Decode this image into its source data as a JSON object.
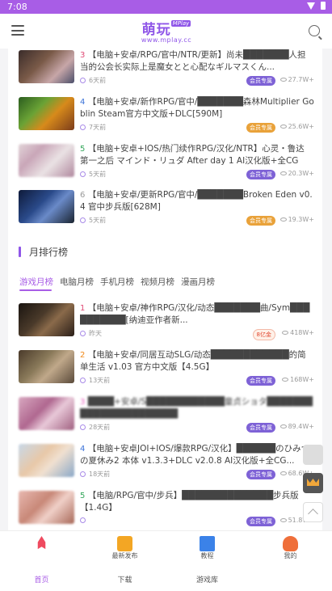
{
  "status": {
    "time": "7:08"
  },
  "header": {
    "logo_cn": "萌玩",
    "logo_tag": "MPlay",
    "logo_url": "www.mplay.cc"
  },
  "hot_list": [
    {
      "num": "3",
      "title": "【电脑+安卓/RPG/官中/NTR/更新】尚未███████人担当的公会长实际上是魔女とと心配なギルマスくん...",
      "time": "6天前",
      "badge": "会员专属",
      "views": "27.7W+"
    },
    {
      "num": "4",
      "title": "【电脑+安卓/新作RPG/官中/███████森林Multiplier Goblin Steam官方中文版+DLC[590M]",
      "time": "7天前",
      "badge": "会员专属",
      "views": "25.6W+"
    },
    {
      "num": "5",
      "title": "【电脑+安卓+IOS/热门续作RPG/汉化/NTR】心灵・鲁达 第一之后 マインド・リュダ After day 1 AI汉化版+全CG回...",
      "time": "5天前",
      "badge": "会员专属",
      "views": "20.3W+"
    },
    {
      "num": "6",
      "title": "【电脑+安卓/更新RPG/官中/███████Broken Eden v0.4 官中步兵版[628M]",
      "time": "5天前",
      "badge": "会员专属",
      "views": "19.3W+"
    }
  ],
  "monthly": {
    "section_title": "月排行榜",
    "tabs": [
      "游戏月榜",
      "电脑月榜",
      "手机月榜",
      "视频月榜",
      "漫画月榜"
    ],
    "items": [
      {
        "num": "1",
        "title": "【电脑+安卓/神作RPG/汉化/动态███████曲/Sym██████████[纳迪亚作者新...",
        "time": "昨天",
        "badge": "8亿金",
        "views": "418W+"
      },
      {
        "num": "2",
        "title": "【电脑+安卓/同居互动SLG/动态████████████的简单生活 v1.03 官方中文版【4.5G】",
        "time": "13天前",
        "badge": "会员专属",
        "views": "168W+"
      },
      {
        "num": "3",
        "title": "████+安卓/S████████████童贞ショタ██████████████████████",
        "time": "28天前",
        "badge": "会员专属",
        "views": "89.4W+"
      },
      {
        "num": "4",
        "title": "【电脑+安卓JOI+IOS/爆款RPG/汉化】██████のひみつの夏休み2 本体 v1.3.3+DLC v2.0.8 AI汉化版+全CG...",
        "time": "18天前",
        "badge": "会员专属",
        "views": "68.6W+"
      },
      {
        "num": "5",
        "title": "【电脑/RPG/官中/步兵】██████████████步兵版【1.4G】",
        "time": "",
        "badge": "会员专属",
        "views": "51.8W+"
      }
    ]
  },
  "bottom_nav": [
    {
      "sub": "",
      "main": "首页"
    },
    {
      "sub": "最新发布",
      "main": "下载"
    },
    {
      "sub": "教程",
      "main": "游戏库"
    },
    {
      "sub": "我的",
      "main": ""
    }
  ]
}
